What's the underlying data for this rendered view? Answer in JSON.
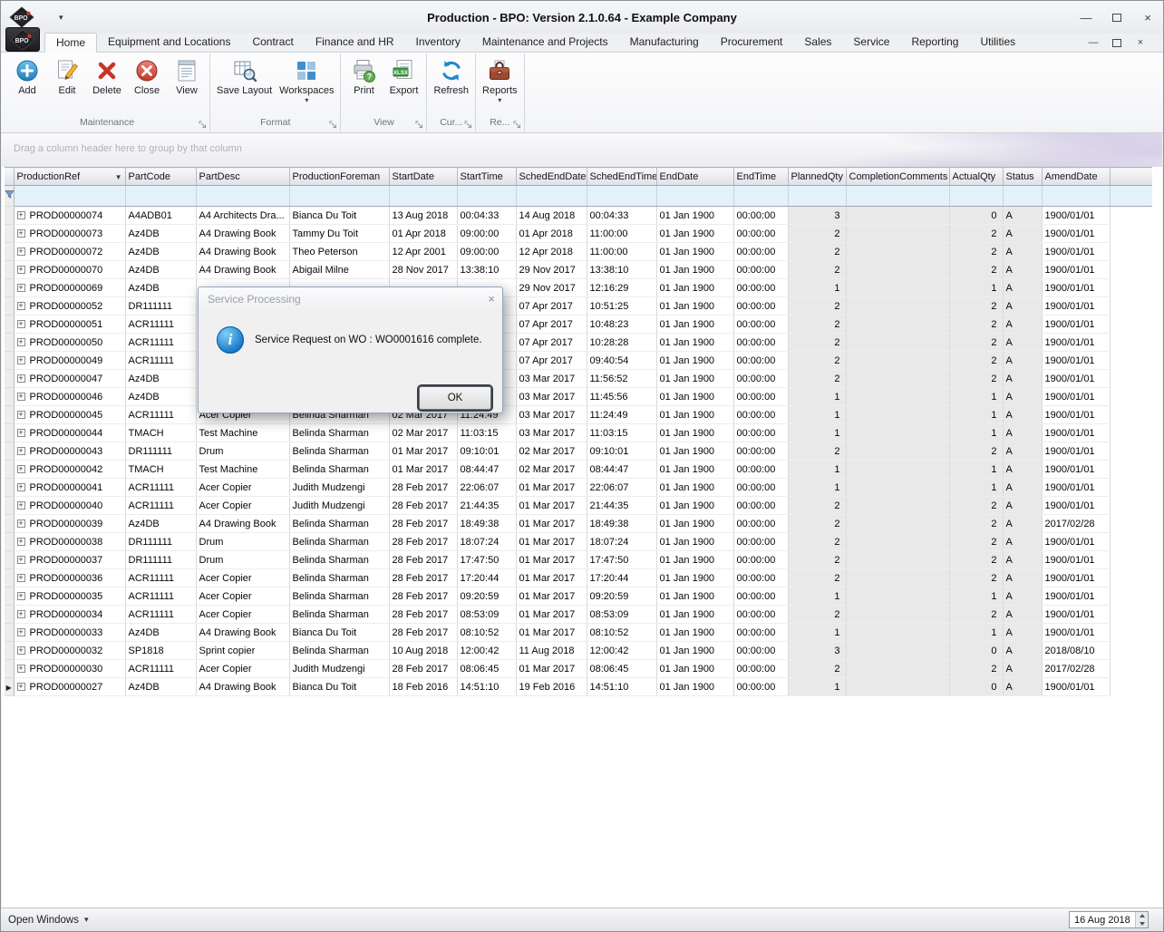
{
  "colors": {
    "ribbon_accent_blue": "#2288cc",
    "delete_red": "#c8332a",
    "info_icon_blue": "#1878c8",
    "filter_row_bg": "#e2f1fa",
    "readonly_cell_bg": "#e9e9ea"
  },
  "window": {
    "title": "Production - BPO: Version 2.1.0.64 - Example Company",
    "logo_text": "BPO"
  },
  "icons": {
    "caret_down": "▾",
    "expand_plus": "+",
    "current_row_arrow": "▶",
    "header_filter_arrow": "▼",
    "minimize": "—",
    "close": "×",
    "info": "i"
  },
  "tabs": [
    {
      "label": "Home",
      "selected": true
    },
    {
      "label": "Equipment and Locations"
    },
    {
      "label": "Contract"
    },
    {
      "label": "Finance and HR"
    },
    {
      "label": "Inventory"
    },
    {
      "label": "Maintenance and Projects"
    },
    {
      "label": "Manufacturing"
    },
    {
      "label": "Procurement"
    },
    {
      "label": "Sales"
    },
    {
      "label": "Service"
    },
    {
      "label": "Reporting"
    },
    {
      "label": "Utilities"
    }
  ],
  "ribbon": {
    "groups": [
      {
        "label": "Maintenance",
        "buttons": [
          {
            "label": "Add",
            "icon": "add-icon"
          },
          {
            "label": "Edit",
            "icon": "edit-icon"
          },
          {
            "label": "Delete",
            "icon": "delete-icon"
          },
          {
            "label": "Close",
            "icon": "close-icon"
          },
          {
            "label": "View",
            "icon": "view-icon"
          }
        ]
      },
      {
        "label": "Format",
        "buttons": [
          {
            "label": "Save Layout",
            "icon": "save-layout-icon"
          },
          {
            "label": "Workspaces",
            "icon": "workspaces-icon",
            "dropdown": true
          }
        ]
      },
      {
        "label": "View",
        "buttons": [
          {
            "label": "Print",
            "icon": "print-icon"
          },
          {
            "label": "Export",
            "icon": "export-icon"
          }
        ]
      },
      {
        "label": "Cur...",
        "buttons": [
          {
            "label": "Refresh",
            "icon": "refresh-icon"
          }
        ]
      },
      {
        "label": "Re...",
        "buttons": [
          {
            "label": "Reports",
            "icon": "reports-icon",
            "dropdown": true
          }
        ]
      }
    ]
  },
  "grid": {
    "group_by_hint": "Drag a column header here to group by that column",
    "columns": [
      "ProductionRef",
      "PartCode",
      "PartDesc",
      "ProductionForeman",
      "StartDate",
      "StartTime",
      "SchedEndDate",
      "SchedEndTime",
      "EndDate",
      "EndTime",
      "PlannedQty",
      "CompletionComments",
      "ActualQty",
      "Status",
      "AmendDate"
    ],
    "current_row": "PROD00000027",
    "rows": [
      [
        "PROD00000074",
        "A4ADB01",
        "A4 Architects Dra...",
        "Bianca Du Toit",
        "13 Aug 2018",
        "00:04:33",
        "14 Aug 2018",
        "00:04:33",
        "01 Jan 1900",
        "00:00:00",
        "3",
        "",
        "0",
        "A",
        "1900/01/01"
      ],
      [
        "PROD00000073",
        "Az4DB",
        "A4 Drawing Book",
        "Tammy Du Toit",
        "01 Apr 2018",
        "09:00:00",
        "01 Apr 2018",
        "11:00:00",
        "01 Jan 1900",
        "00:00:00",
        "2",
        "",
        "2",
        "A",
        "1900/01/01"
      ],
      [
        "PROD00000072",
        "Az4DB",
        "A4 Drawing Book",
        "Theo Peterson",
        "12 Apr 2001",
        "09:00:00",
        "12 Apr 2018",
        "11:00:00",
        "01 Jan 1900",
        "00:00:00",
        "2",
        "",
        "2",
        "A",
        "1900/01/01"
      ],
      [
        "PROD00000070",
        "Az4DB",
        "A4 Drawing Book",
        "Abigail Milne",
        "28 Nov 2017",
        "13:38:10",
        "29 Nov 2017",
        "13:38:10",
        "01 Jan 1900",
        "00:00:00",
        "2",
        "",
        "2",
        "A",
        "1900/01/01"
      ],
      [
        "PROD00000069",
        "Az4DB",
        "",
        "",
        "",
        "",
        "29 Nov 2017",
        "12:16:29",
        "01 Jan 1900",
        "00:00:00",
        "1",
        "",
        "1",
        "A",
        "1900/01/01"
      ],
      [
        "PROD00000052",
        "DR111111",
        "",
        "",
        "",
        "",
        "07 Apr 2017",
        "10:51:25",
        "01 Jan 1900",
        "00:00:00",
        "2",
        "",
        "2",
        "A",
        "1900/01/01"
      ],
      [
        "PROD00000051",
        "ACR11111",
        "",
        "",
        "",
        "",
        "07 Apr 2017",
        "10:48:23",
        "01 Jan 1900",
        "00:00:00",
        "2",
        "",
        "2",
        "A",
        "1900/01/01"
      ],
      [
        "PROD00000050",
        "ACR11111",
        "",
        "",
        "",
        "",
        "07 Apr 2017",
        "10:28:28",
        "01 Jan 1900",
        "00:00:00",
        "2",
        "",
        "2",
        "A",
        "1900/01/01"
      ],
      [
        "PROD00000049",
        "ACR11111",
        "",
        "",
        "",
        "",
        "07 Apr 2017",
        "09:40:54",
        "01 Jan 1900",
        "00:00:00",
        "2",
        "",
        "2",
        "A",
        "1900/01/01"
      ],
      [
        "PROD00000047",
        "Az4DB",
        "",
        "",
        "",
        "",
        "03 Mar 2017",
        "11:56:52",
        "01 Jan 1900",
        "00:00:00",
        "2",
        "",
        "2",
        "A",
        "1900/01/01"
      ],
      [
        "PROD00000046",
        "Az4DB",
        "",
        "",
        "",
        "",
        "03 Mar 2017",
        "11:45:56",
        "01 Jan 1900",
        "00:00:00",
        "1",
        "",
        "1",
        "A",
        "1900/01/01"
      ],
      [
        "PROD00000045",
        "ACR11111",
        "Acer Copier",
        "Belinda Sharman",
        "02 Mar 2017",
        "11:24:49",
        "03 Mar 2017",
        "11:24:49",
        "01 Jan 1900",
        "00:00:00",
        "1",
        "",
        "1",
        "A",
        "1900/01/01"
      ],
      [
        "PROD00000044",
        "TMACH",
        "Test Machine",
        "Belinda Sharman",
        "02 Mar 2017",
        "11:03:15",
        "03 Mar 2017",
        "11:03:15",
        "01 Jan 1900",
        "00:00:00",
        "1",
        "",
        "1",
        "A",
        "1900/01/01"
      ],
      [
        "PROD00000043",
        "DR111111",
        "Drum",
        "Belinda Sharman",
        "01 Mar 2017",
        "09:10:01",
        "02 Mar 2017",
        "09:10:01",
        "01 Jan 1900",
        "00:00:00",
        "2",
        "",
        "2",
        "A",
        "1900/01/01"
      ],
      [
        "PROD00000042",
        "TMACH",
        "Test Machine",
        "Belinda Sharman",
        "01 Mar 2017",
        "08:44:47",
        "02 Mar 2017",
        "08:44:47",
        "01 Jan 1900",
        "00:00:00",
        "1",
        "",
        "1",
        "A",
        "1900/01/01"
      ],
      [
        "PROD00000041",
        "ACR11111",
        "Acer Copier",
        "Judith Mudzengi",
        "28 Feb 2017",
        "22:06:07",
        "01 Mar 2017",
        "22:06:07",
        "01 Jan 1900",
        "00:00:00",
        "1",
        "",
        "1",
        "A",
        "1900/01/01"
      ],
      [
        "PROD00000040",
        "ACR11111",
        "Acer Copier",
        "Judith Mudzengi",
        "28 Feb 2017",
        "21:44:35",
        "01 Mar 2017",
        "21:44:35",
        "01 Jan 1900",
        "00:00:00",
        "2",
        "",
        "2",
        "A",
        "1900/01/01"
      ],
      [
        "PROD00000039",
        "Az4DB",
        "A4 Drawing Book",
        "Belinda Sharman",
        "28 Feb 2017",
        "18:49:38",
        "01 Mar 2017",
        "18:49:38",
        "01 Jan 1900",
        "00:00:00",
        "2",
        "",
        "2",
        "A",
        "2017/02/28"
      ],
      [
        "PROD00000038",
        "DR111111",
        "Drum",
        "Belinda Sharman",
        "28 Feb 2017",
        "18:07:24",
        "01 Mar 2017",
        "18:07:24",
        "01 Jan 1900",
        "00:00:00",
        "2",
        "",
        "2",
        "A",
        "1900/01/01"
      ],
      [
        "PROD00000037",
        "DR111111",
        "Drum",
        "Belinda Sharman",
        "28 Feb 2017",
        "17:47:50",
        "01 Mar 2017",
        "17:47:50",
        "01 Jan 1900",
        "00:00:00",
        "2",
        "",
        "2",
        "A",
        "1900/01/01"
      ],
      [
        "PROD00000036",
        "ACR11111",
        "Acer Copier",
        "Belinda Sharman",
        "28 Feb 2017",
        "17:20:44",
        "01 Mar 2017",
        "17:20:44",
        "01 Jan 1900",
        "00:00:00",
        "2",
        "",
        "2",
        "A",
        "1900/01/01"
      ],
      [
        "PROD00000035",
        "ACR11111",
        "Acer Copier",
        "Belinda Sharman",
        "28 Feb 2017",
        "09:20:59",
        "01 Mar 2017",
        "09:20:59",
        "01 Jan 1900",
        "00:00:00",
        "1",
        "",
        "1",
        "A",
        "1900/01/01"
      ],
      [
        "PROD00000034",
        "ACR11111",
        "Acer Copier",
        "Belinda Sharman",
        "28 Feb 2017",
        "08:53:09",
        "01 Mar 2017",
        "08:53:09",
        "01 Jan 1900",
        "00:00:00",
        "2",
        "",
        "2",
        "A",
        "1900/01/01"
      ],
      [
        "PROD00000033",
        "Az4DB",
        "A4 Drawing Book",
        "Bianca Du Toit",
        "28 Feb 2017",
        "08:10:52",
        "01 Mar 2017",
        "08:10:52",
        "01 Jan 1900",
        "00:00:00",
        "1",
        "",
        "1",
        "A",
        "1900/01/01"
      ],
      [
        "PROD00000032",
        "SP1818",
        "Sprint copier",
        "Belinda Sharman",
        "10 Aug 2018",
        "12:00:42",
        "11 Aug 2018",
        "12:00:42",
        "01 Jan 1900",
        "00:00:00",
        "3",
        "",
        "0",
        "A",
        "2018/08/10"
      ],
      [
        "PROD00000030",
        "ACR11111",
        "Acer Copier",
        "Judith Mudzengi",
        "28 Feb 2017",
        "08:06:45",
        "01 Mar 2017",
        "08:06:45",
        "01 Jan 1900",
        "00:00:00",
        "2",
        "",
        "2",
        "A",
        "2017/02/28"
      ],
      [
        "PROD00000027",
        "Az4DB",
        "A4 Drawing Book",
        "Bianca Du Toit",
        "18 Feb 2016",
        "14:51:10",
        "19 Feb 2016",
        "14:51:10",
        "01 Jan 1900",
        "00:00:00",
        "1",
        "",
        "0",
        "A",
        "1900/01/01"
      ]
    ]
  },
  "dialog": {
    "title": "Service Processing",
    "message": "Service Request on WO : WO0001616 complete.",
    "ok_label": "OK"
  },
  "statusbar": {
    "open_windows_label": "Open Windows",
    "date_value": "16 Aug 2018"
  }
}
